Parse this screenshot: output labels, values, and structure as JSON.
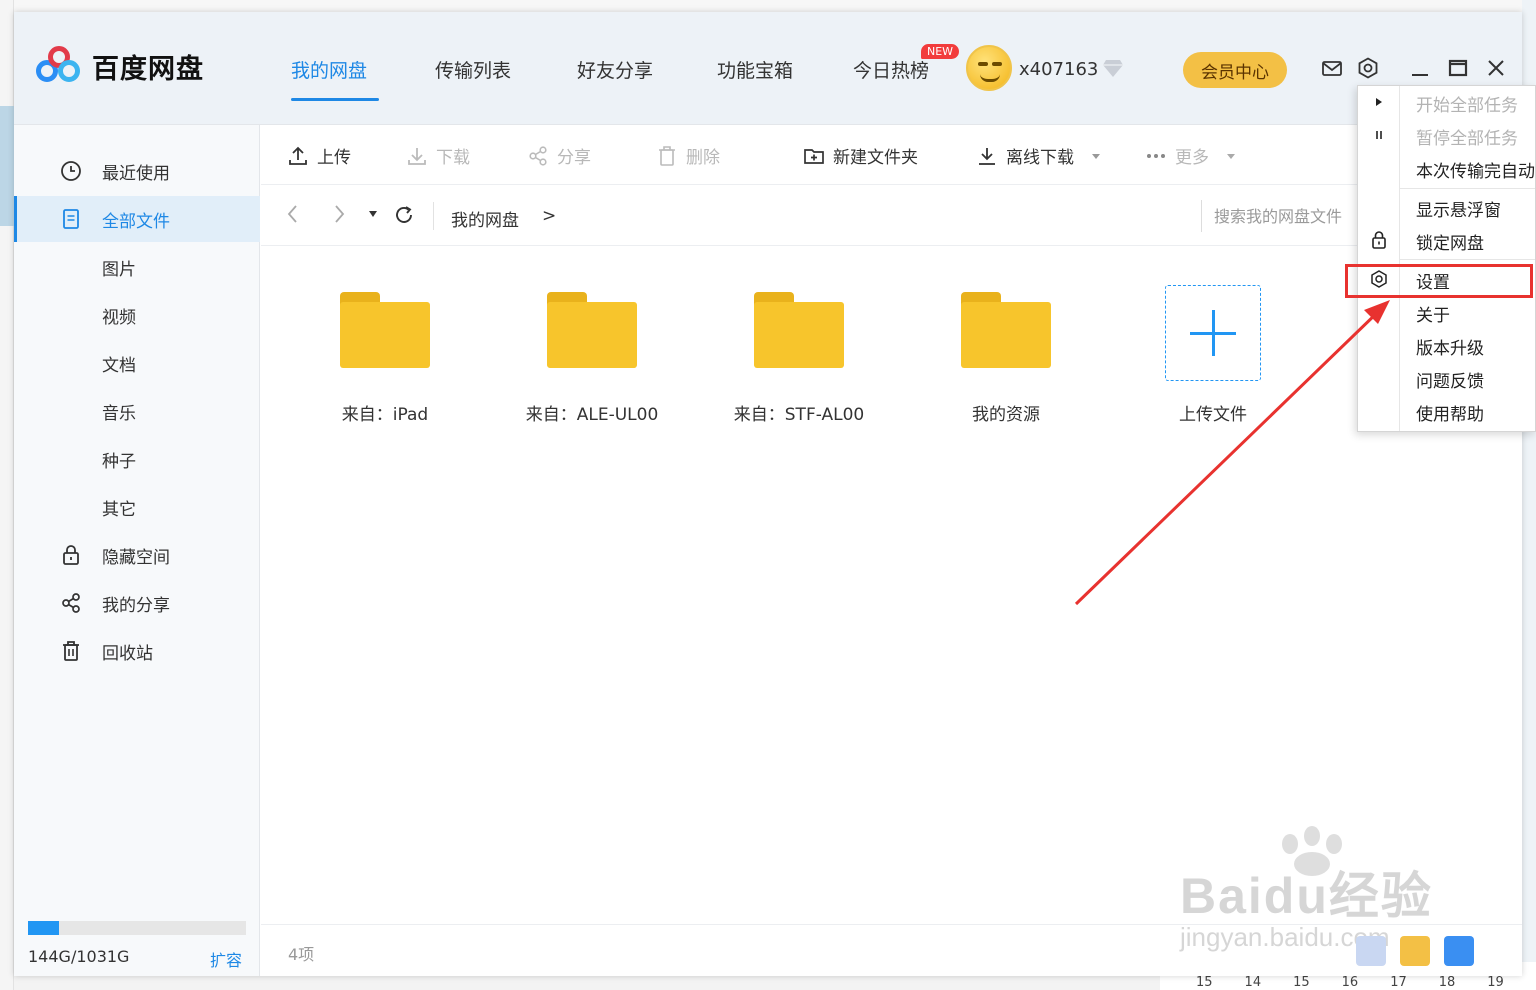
{
  "app": {
    "name": "百度网盘"
  },
  "nav": {
    "tabs": [
      "我的网盘",
      "传输列表",
      "好友分享",
      "功能宝箱",
      "今日热榜"
    ],
    "new_badge": "NEW"
  },
  "user": {
    "name": "x407163",
    "vip_button": "会员中心"
  },
  "sidebar": {
    "items": [
      "最近使用",
      "全部文件",
      "图片",
      "视频",
      "文档",
      "音乐",
      "种子",
      "其它",
      "隐藏空间",
      "我的分享",
      "回收站"
    ],
    "quota_text": "144G/1031G",
    "quota_fraction": 0.14,
    "expand_label": "扩容"
  },
  "toolbar": {
    "upload": "上传",
    "download": "下载",
    "share": "分享",
    "delete": "删除",
    "new_folder": "新建文件夹",
    "offline_download": "离线下载",
    "more": "更多"
  },
  "addressbar": {
    "crumb": "我的网盘",
    "separator": ">",
    "search_placeholder": "搜索我的网盘文件"
  },
  "files": [
    {
      "name": "来自：iPad"
    },
    {
      "name": "来自：ALE-UL00"
    },
    {
      "name": "来自：STF-AL00"
    },
    {
      "name": "我的资源"
    }
  ],
  "upload_tile_label": "上传文件",
  "status": {
    "item_count": "4项"
  },
  "menu": {
    "start_all": "开始全部任务",
    "pause_all": "暂停全部任务",
    "auto_after": "本次传输完自动",
    "show_float": "显示悬浮窗",
    "lock": "锁定网盘",
    "settings": "设置",
    "about": "关于",
    "upgrade": "版本升级",
    "feedback": "问题反馈",
    "help": "使用帮助"
  },
  "watermark": {
    "line1": "Baidu经验",
    "line2": "jingyan.baidu.com"
  },
  "calendar_strip": [
    "15",
    "14",
    "15",
    "16",
    "17",
    "18",
    "19"
  ],
  "colors": {
    "accent": "#1e88e5",
    "vip": "#f3c045",
    "folder": "#f7c52c",
    "highlight": "#e8322f"
  }
}
